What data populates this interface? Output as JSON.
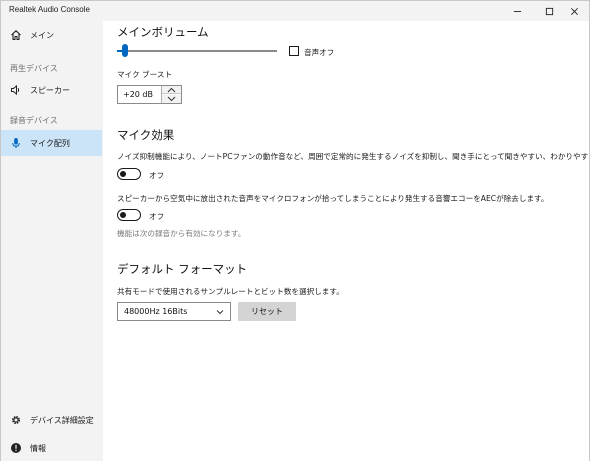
{
  "window": {
    "title": "Realtek Audio Console"
  },
  "sidebar": {
    "main_item": {
      "label": "メイン",
      "icon": "home-icon"
    },
    "playback_section": "再生デバイス",
    "speaker_item": {
      "label": "スピーカー",
      "icon": "speaker-icon"
    },
    "recording_section": "録音デバイス",
    "mic_item": {
      "label": "マイク配列",
      "icon": "microphone-icon",
      "active": true
    },
    "settings_item": {
      "label": "デバイス詳細設定",
      "icon": "gear-icon"
    },
    "info_item": {
      "label": "情報",
      "icon": "info-icon"
    }
  },
  "main": {
    "volume": {
      "heading": "メインボリューム",
      "level": 0.05,
      "mute_label": "音声オフ",
      "mute_checked": false
    },
    "boost": {
      "label": "マイク ブースト",
      "value": "+20 dB"
    },
    "effects": {
      "heading": "マイク効果",
      "noise_desc": "ノイズ抑制機能により、ノートPCファンの動作音など、周囲で定常的に発生するノイズを抑制し、聞き手にとって聞きやすい、わかりやすい音声とします。",
      "noise_toggle_label": "オフ",
      "aec_desc": "スピーカーから空気中に放出された音声をマイクロフォンが拾ってしまうことにより発生する音響エコーをAECが除去します。",
      "aec_toggle_label": "オフ",
      "note": "機能は次の録音から有効になります。"
    },
    "format": {
      "heading": "デフォルト フォーマット",
      "desc": "共有モードで使用されるサンプルレートとビット数を選択します。",
      "selected": "48000Hz 16Bits",
      "reset_label": "リセット"
    }
  },
  "colors": {
    "accent": "#0067c0",
    "active_nav": "#cce4f7"
  }
}
